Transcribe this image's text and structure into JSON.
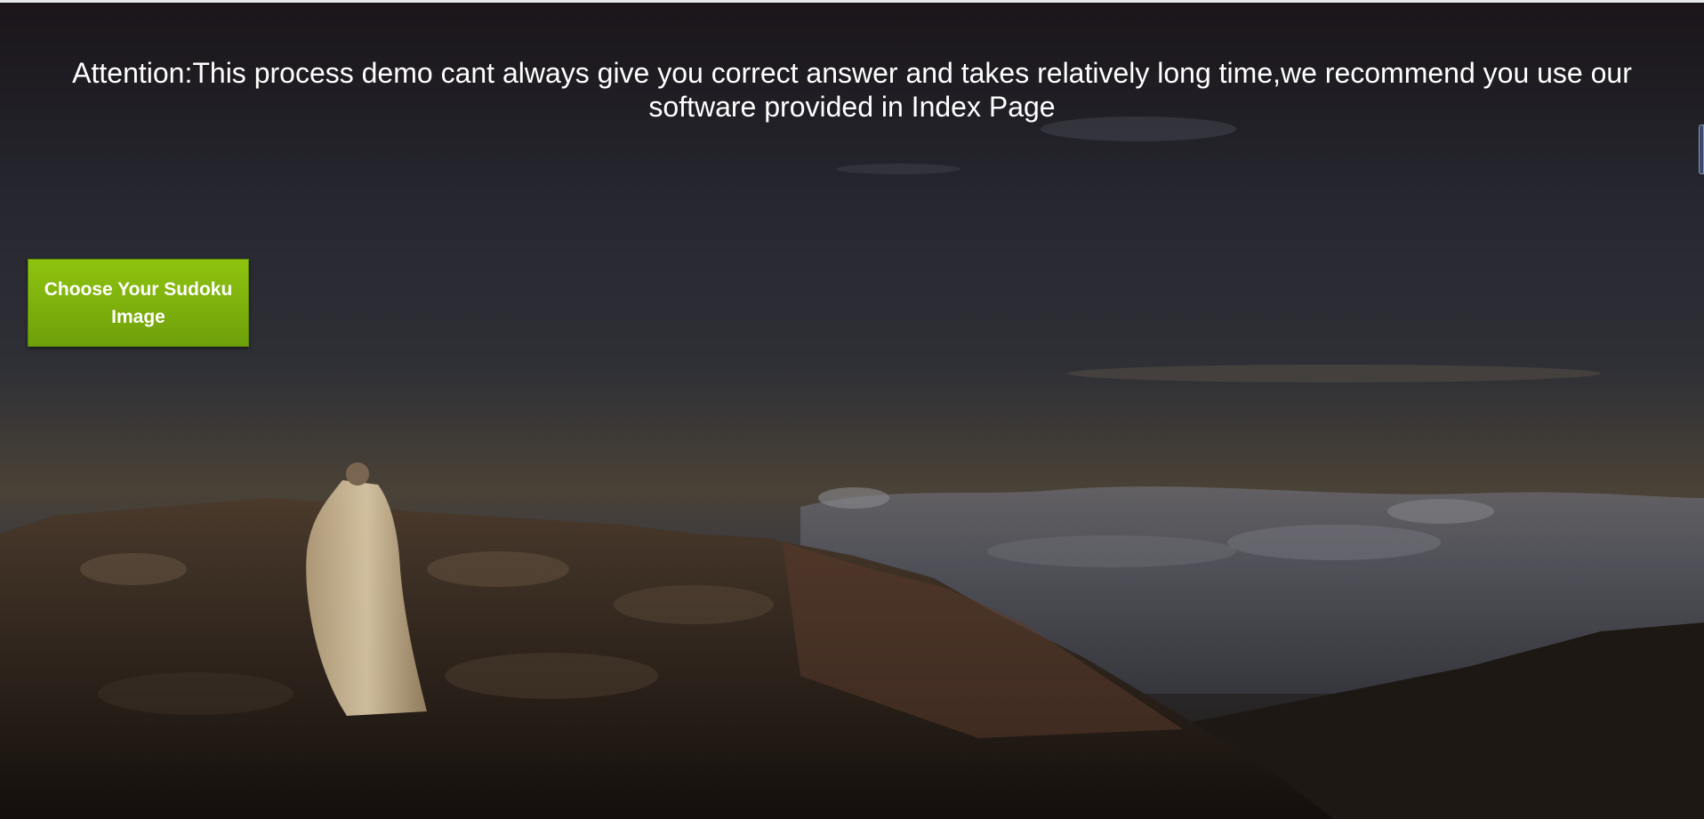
{
  "notice": {
    "line1": "Attention:This process demo cant always give you correct answer and takes relatively long time,we recommend you use our",
    "line2": "software provided in Index Page"
  },
  "choose_button": {
    "label": "Choose Your Sudoku Image"
  },
  "background": {
    "description_icon": "mountain-summit-background",
    "sky_color": "#2a2a33",
    "ground_color": "#1c1612",
    "button_color": "#7fb20d"
  }
}
